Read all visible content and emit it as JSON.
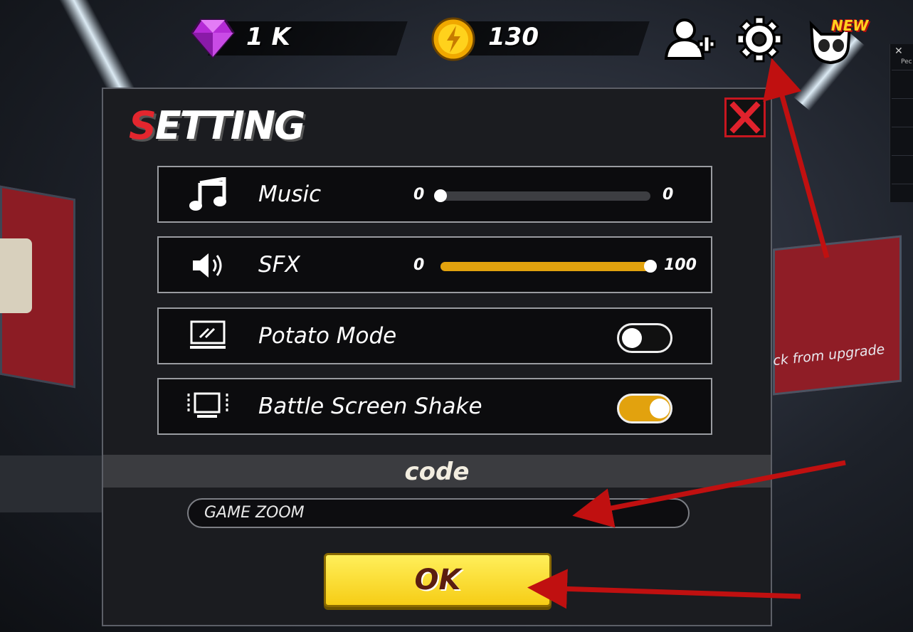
{
  "currency": {
    "gems": "1 K",
    "coins": "130"
  },
  "top_icons": [
    "add-friend-icon",
    "gear-icon",
    "pet-icon"
  ],
  "top_new_badge": "NEW",
  "side_panel": {
    "label": "Pec"
  },
  "background": {
    "banner_text": "ck from upgrade"
  },
  "dialog": {
    "title_first": "S",
    "title_rest": "ETTING",
    "rows": {
      "music": {
        "label": "Music",
        "min": "0",
        "max": "0",
        "value": 0
      },
      "sfx": {
        "label": "SFX",
        "min": "0",
        "max": "100",
        "value": 1.0
      },
      "potato": {
        "label": "Potato Mode",
        "on": false
      },
      "shake": {
        "label": "Battle Screen Shake",
        "on": true
      }
    },
    "code_label": "code",
    "code_input_value": "GAME ZOOM",
    "ok_label": "OK"
  },
  "colors": {
    "accent": "#e2a20e",
    "close_red": "#c7161f",
    "ok_yellow": "#f6cd16",
    "arrow_red": "#c01010"
  }
}
